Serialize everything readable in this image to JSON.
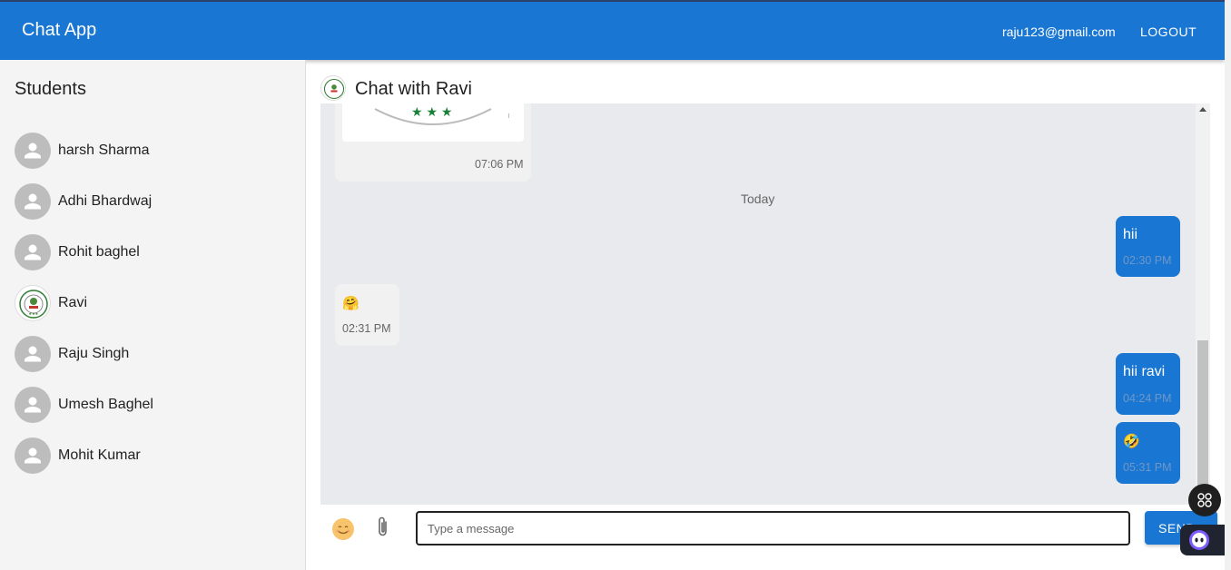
{
  "app": {
    "title": "Chat App"
  },
  "header": {
    "user_email": "raju123@gmail.com",
    "logout_label": "LOGOUT"
  },
  "sidebar": {
    "heading": "Students",
    "students": [
      {
        "name": "harsh Sharma",
        "avatar": "person-icon"
      },
      {
        "name": "Adhi Bhardwaj",
        "avatar": "person-icon"
      },
      {
        "name": "Rohit baghel",
        "avatar": "person-icon"
      },
      {
        "name": "Ravi",
        "avatar": "emblem-avatar"
      },
      {
        "name": "Raju Singh",
        "avatar": "person-icon"
      },
      {
        "name": "Umesh Baghel",
        "avatar": "person-icon"
      },
      {
        "name": "Mohit Kumar",
        "avatar": "person-icon"
      }
    ]
  },
  "chat": {
    "title": "Chat with Ravi",
    "day_divider": "Today",
    "messages": [
      {
        "direction": "received",
        "type": "image",
        "time": "07:06 PM"
      },
      {
        "direction": "sent",
        "text": "hii",
        "time": "02:30 PM"
      },
      {
        "direction": "received",
        "text": "🤗",
        "time": "02:31 PM"
      },
      {
        "direction": "sent",
        "text": "hii ravi",
        "time": "04:24 PM"
      },
      {
        "direction": "sent",
        "text": "🤣",
        "time": "05:31 PM"
      }
    ]
  },
  "composer": {
    "placeholder": "Type a message",
    "value": "",
    "send_label": "SEND",
    "emoji_icon": "smiley-emoji-icon",
    "attach_icon": "paperclip-icon"
  },
  "colors": {
    "primary": "#1976d2",
    "sidebar_bg": "#f4f4f4",
    "chat_bg": "#e8eaed"
  }
}
